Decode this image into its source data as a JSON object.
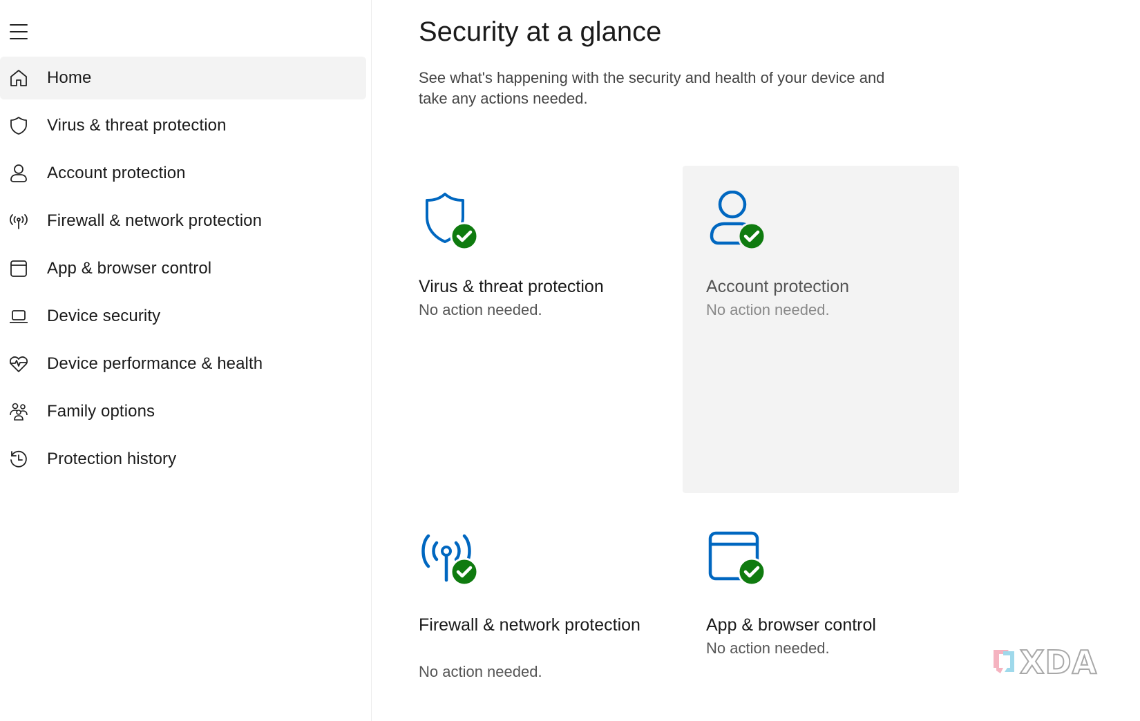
{
  "colors": {
    "accent_blue": "#0067c0",
    "check_green": "#0f7b0f",
    "active_bg": "#f3f3f3"
  },
  "sidebar": {
    "menu_icon": "hamburger-icon",
    "items": [
      {
        "label": "Home",
        "icon": "home-icon",
        "active": true
      },
      {
        "label": "Virus & threat protection",
        "icon": "shield-icon"
      },
      {
        "label": "Account protection",
        "icon": "person-icon"
      },
      {
        "label": "Firewall & network protection",
        "icon": "antenna-icon"
      },
      {
        "label": "App & browser control",
        "icon": "browser-window-icon"
      },
      {
        "label": "Device security",
        "icon": "laptop-icon"
      },
      {
        "label": "Device performance & health",
        "icon": "heart-pulse-icon"
      },
      {
        "label": "Family options",
        "icon": "family-icon"
      },
      {
        "label": "Protection history",
        "icon": "history-icon"
      }
    ]
  },
  "main": {
    "title": "Security at a glance",
    "description": "See what's happening with the security and health of your device and take any actions needed.",
    "tiles": [
      {
        "title": "Virus & threat protection",
        "status": "No action needed.",
        "icon": "shield-check-icon"
      },
      {
        "title": "Account protection",
        "status": "No action needed.",
        "icon": "person-check-icon"
      },
      {
        "title": "Firewall & network protection",
        "status": "No action needed.",
        "icon": "antenna-check-icon"
      },
      {
        "title": "App & browser control",
        "status": "No action needed.",
        "icon": "browser-check-icon"
      }
    ]
  },
  "watermark": {
    "text": "XDA"
  }
}
